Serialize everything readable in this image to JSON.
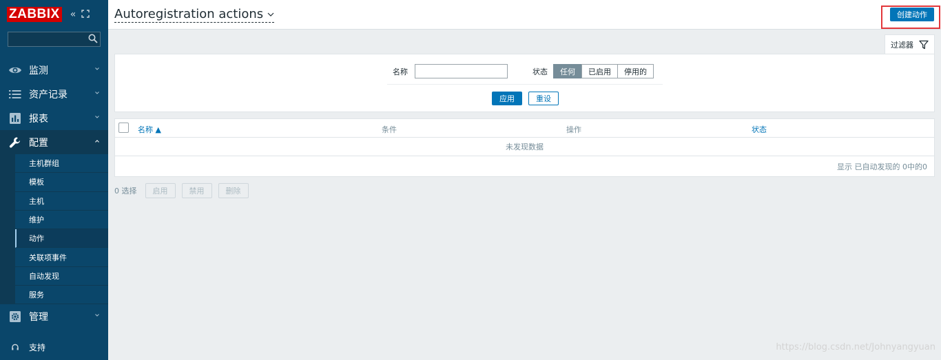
{
  "sidebar": {
    "logo": "ZABBIX",
    "search": {
      "placeholder": ""
    },
    "menu": [
      {
        "label": "监测",
        "icon": "eye-icon"
      },
      {
        "label": "资产记录",
        "icon": "list-icon"
      },
      {
        "label": "报表",
        "icon": "bar-chart-icon"
      },
      {
        "label": "配置",
        "icon": "wrench-icon",
        "expanded": true
      },
      {
        "label": "管理",
        "icon": "gear-icon"
      }
    ],
    "submenu": [
      {
        "label": "主机群组"
      },
      {
        "label": "模板"
      },
      {
        "label": "主机"
      },
      {
        "label": "维护"
      },
      {
        "label": "动作",
        "selected": true
      },
      {
        "label": "关联项事件"
      },
      {
        "label": "自动发现"
      },
      {
        "label": "服务"
      }
    ],
    "support_label": "支持"
  },
  "header": {
    "title": "Autoregistration actions",
    "create_button": "创建动作"
  },
  "filter": {
    "tab_label": "过滤器",
    "name_label": "名称",
    "name_value": "",
    "status_label": "状态",
    "status_options": [
      "任何",
      "已启用",
      "停用的"
    ],
    "status_selected": "任何",
    "apply_label": "应用",
    "reset_label": "重设"
  },
  "table": {
    "columns": [
      "名称 ▲",
      "条件",
      "操作",
      "状态"
    ],
    "empty_text": "未发现数据",
    "paging_text": "显示 已自动发现的 0中的0"
  },
  "bulk": {
    "selected_count": "0 选择",
    "enable_label": "启用",
    "disable_label": "禁用",
    "delete_label": "删除"
  },
  "watermark": "https://blog.csdn.net/Johnyangyuan",
  "colors": {
    "sidebar_bg": "#0a466a",
    "accent": "#0275b8",
    "logo_red": "#d40000",
    "highlight_red": "#e2363a"
  }
}
